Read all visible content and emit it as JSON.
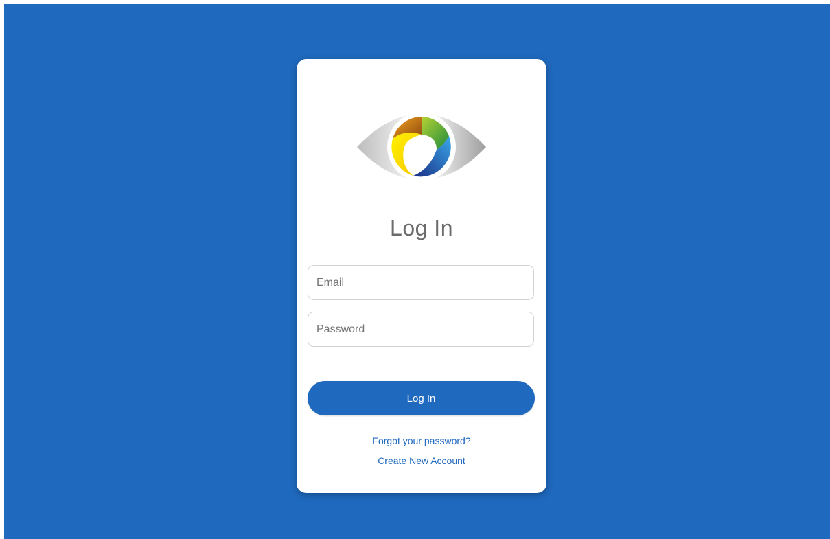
{
  "page": {
    "background_color": "#1f69be"
  },
  "login": {
    "logo_icon": "eye-logo-icon",
    "title": "Log In",
    "email_placeholder": "Email",
    "email_value": "",
    "password_placeholder": "Password",
    "password_value": "",
    "submit_label": "Log In",
    "forgot_password_label": "Forgot your password?",
    "create_account_label": "Create New Account",
    "accent_color": "#1f69be"
  }
}
